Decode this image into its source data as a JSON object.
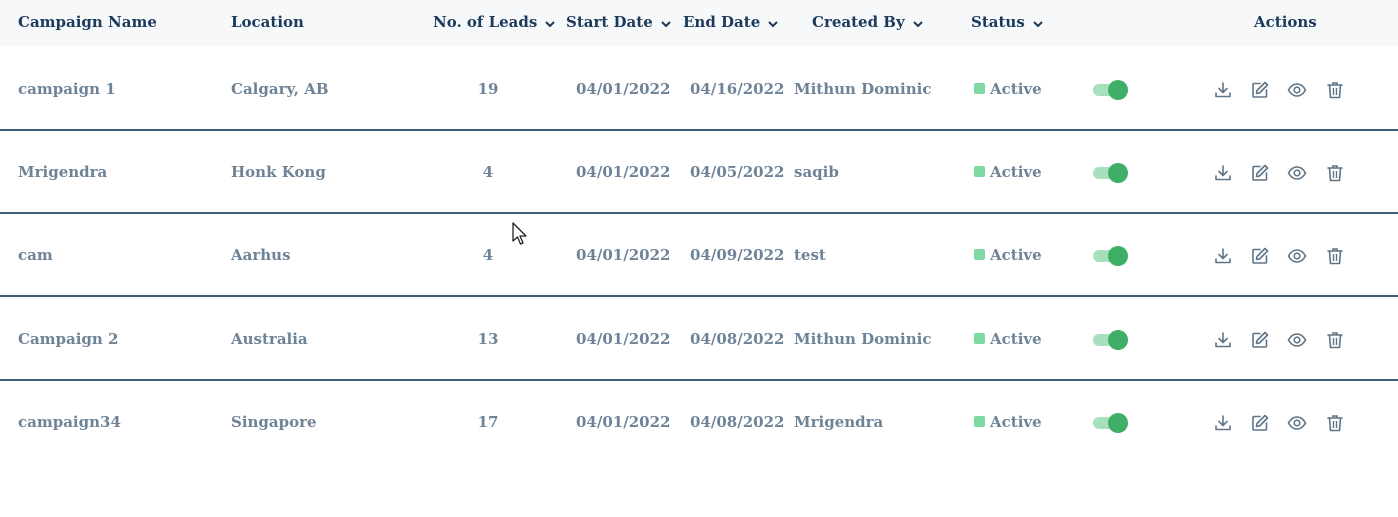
{
  "columns": {
    "campaign_name": "Campaign Name",
    "location": "Location",
    "leads": "No. of Leads",
    "start_date": "Start Date",
    "end_date": "End Date",
    "created_by": "Created By",
    "status": "Status",
    "actions": "Actions"
  },
  "rows": [
    {
      "name": "campaign 1",
      "location": "Calgary, AB",
      "leads": "19",
      "start": "04/01/2022",
      "end": "04/16/2022",
      "created_by": "Mithun Dominic",
      "status": "Active",
      "enabled": true
    },
    {
      "name": "Mrigendra",
      "location": "Honk Kong",
      "leads": "4",
      "start": "04/01/2022",
      "end": "04/05/2022",
      "created_by": "saqib",
      "status": "Active",
      "enabled": true
    },
    {
      "name": "cam",
      "location": "Aarhus",
      "leads": "4",
      "start": "04/01/2022",
      "end": "04/09/2022",
      "created_by": "test",
      "status": "Active",
      "enabled": true
    },
    {
      "name": "Campaign 2",
      "location": "Australia",
      "leads": "13",
      "start": "04/01/2022",
      "end": "04/08/2022",
      "created_by": "Mithun Dominic",
      "status": "Active",
      "enabled": true
    },
    {
      "name": "campaign34",
      "location": "Singapore",
      "leads": "17",
      "start": "04/01/2022",
      "end": "04/08/2022",
      "created_by": "Mrigendra",
      "status": "Active",
      "enabled": true
    }
  ],
  "icons": {
    "sort": "chevron-down-icon",
    "download": "download-icon",
    "edit": "edit-icon",
    "view": "eye-icon",
    "delete": "trash-icon"
  },
  "colors": {
    "header_text": "#1b3a5c",
    "cell_text": "#6e8397",
    "active_green": "#3fae66",
    "status_dot": "#7fd9a3",
    "row_divider": "#3f5c78"
  }
}
